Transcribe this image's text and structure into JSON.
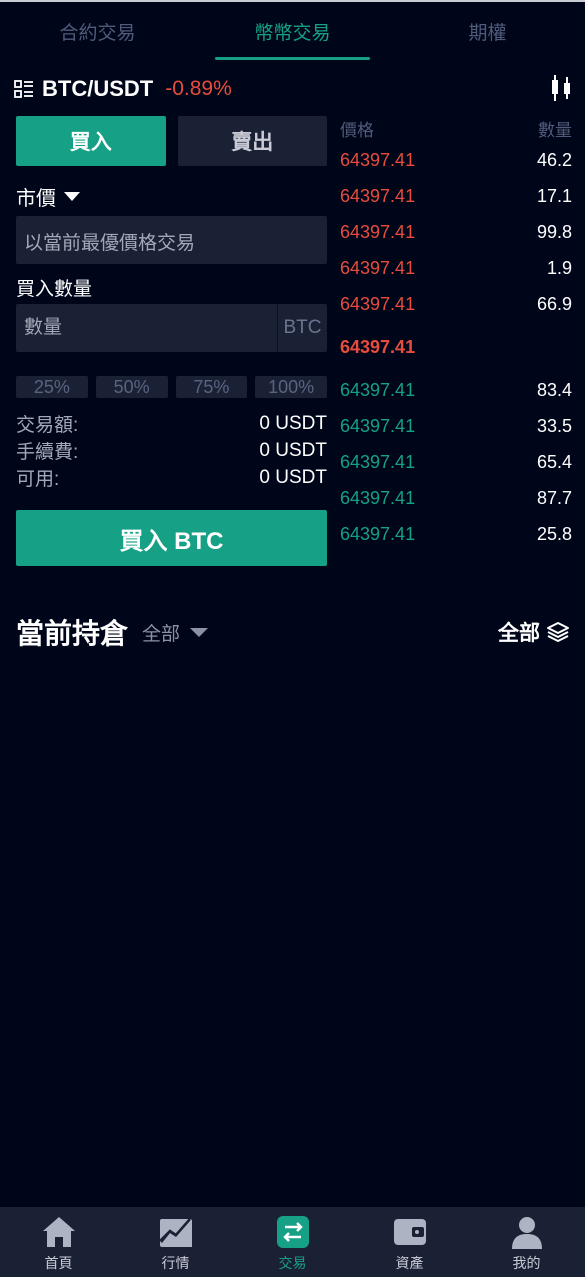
{
  "top_tabs": [
    {
      "label": "合約交易",
      "active": false
    },
    {
      "label": "幣幣交易",
      "active": true
    },
    {
      "label": "期權",
      "active": false
    }
  ],
  "pair": {
    "name": "BTC/USDT",
    "change": "-0.89%",
    "change_color": "#e74c3c"
  },
  "side_tabs": {
    "buy_label": "買入",
    "sell_label": "賣出"
  },
  "order_type": {
    "label": "市價"
  },
  "price_box": {
    "text": "以當前最優價格交易"
  },
  "quantity": {
    "label": "買入數量",
    "placeholder": "數量",
    "value": "",
    "unit": "BTC"
  },
  "percent_buttons": [
    "25%",
    "50%",
    "75%",
    "100%"
  ],
  "summary": [
    {
      "label": "交易額:",
      "value": "0 USDT"
    },
    {
      "label": "手續費:",
      "value": "0 USDT"
    },
    {
      "label": "可用:",
      "value": "0 USDT"
    }
  ],
  "submit": {
    "label": "買入 BTC"
  },
  "order_book": {
    "price_header": "價格",
    "qty_header": "數量",
    "asks": [
      {
        "price": "64397.41",
        "qty": "46.2"
      },
      {
        "price": "64397.41",
        "qty": "17.1"
      },
      {
        "price": "64397.41",
        "qty": "99.8"
      },
      {
        "price": "64397.41",
        "qty": "1.9"
      },
      {
        "price": "64397.41",
        "qty": "66.9"
      }
    ],
    "last_price": "64397.41",
    "bids": [
      {
        "price": "64397.41",
        "qty": "83.4"
      },
      {
        "price": "64397.41",
        "qty": "33.5"
      },
      {
        "price": "64397.41",
        "qty": "65.4"
      },
      {
        "price": "64397.41",
        "qty": "87.7"
      },
      {
        "price": "64397.41",
        "qty": "25.8"
      }
    ]
  },
  "positions": {
    "title": "當前持倉",
    "filter": "全部",
    "all_label": "全部"
  },
  "bottom_nav": [
    {
      "label": "首頁",
      "icon": "home-icon",
      "active": false
    },
    {
      "label": "行情",
      "icon": "market-chart-icon",
      "active": false
    },
    {
      "label": "交易",
      "icon": "exchange-icon",
      "active": true
    },
    {
      "label": "資產",
      "icon": "wallet-icon",
      "active": false
    },
    {
      "label": "我的",
      "icon": "user-icon",
      "active": false
    }
  ],
  "colors": {
    "background": "#00061a",
    "accent_green": "#16a085",
    "red": "#e74c3c",
    "panel": "#1b2135"
  }
}
